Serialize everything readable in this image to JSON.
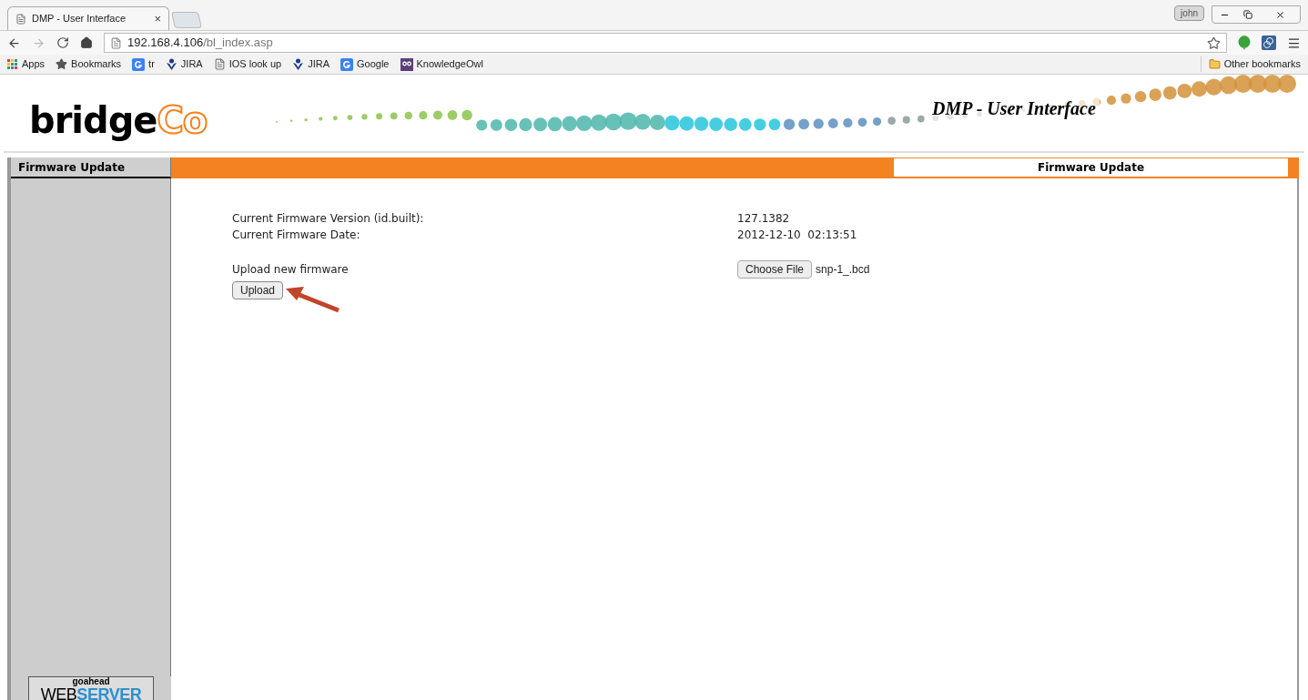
{
  "browser": {
    "tabs": [
      {
        "title": "DMP - User Interface",
        "close": "×",
        "selected": true
      }
    ],
    "profile": "john",
    "address": {
      "host": "192.168.4.106",
      "path": "/bl_index.asp"
    },
    "bookmarks": [
      {
        "kind": "apps",
        "label": "Apps"
      },
      {
        "kind": "star",
        "label": "Bookmarks"
      },
      {
        "kind": "google",
        "label": "tr"
      },
      {
        "kind": "jira",
        "label": "JIRA"
      },
      {
        "kind": "page",
        "label": "IOS look up"
      },
      {
        "kind": "jira",
        "label": "JIRA"
      },
      {
        "kind": "google",
        "label": "Google"
      },
      {
        "kind": "owl",
        "label": "KnowledgeOwl"
      }
    ],
    "other_bookmarks": "Other bookmarks"
  },
  "header": {
    "logo": {
      "main": "bridge",
      "accent": "Co"
    },
    "title": "DMP - User Interface"
  },
  "sidebar": {
    "items": [
      {
        "label": "Firmware Update",
        "selected": true
      }
    ],
    "badge": {
      "top": "goahead",
      "left": "WEB",
      "right": "SERVER"
    }
  },
  "page": {
    "heading": "Firmware Update",
    "rows": [
      {
        "label": "Current Firmware Version (id.built):",
        "value": "127.1382"
      },
      {
        "label": "Current Firmware Date:",
        "value": "2012-12-10  02:13:51"
      }
    ],
    "upload": {
      "label": "Upload new firmware",
      "choose_button": "Choose File",
      "file_name": "snp-1_.bcd",
      "upload_button": "Upload"
    }
  }
}
